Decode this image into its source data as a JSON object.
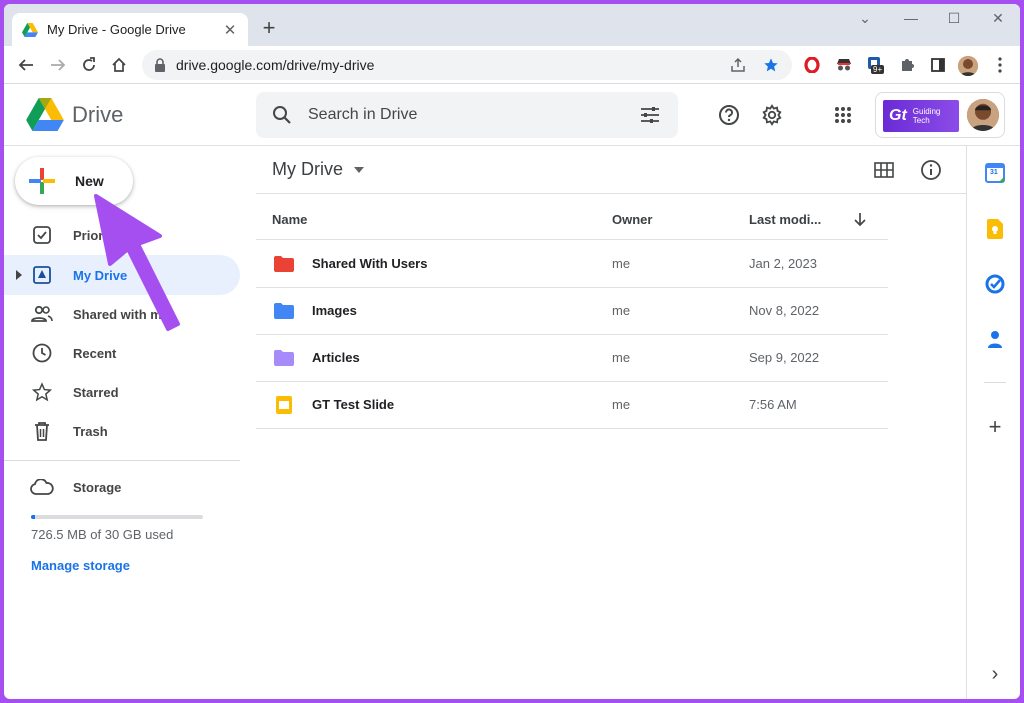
{
  "browser": {
    "tab_title": "My Drive - Google Drive",
    "tab_close": "✕",
    "new_tab": "+",
    "window_controls": [
      "⌄",
      "—",
      "☐",
      "✕"
    ],
    "url": "drive.google.com/drive/my-drive",
    "extension_badge": "9+"
  },
  "header": {
    "app_name": "Drive",
    "search_placeholder": "Search in Drive",
    "account_brand_line1": "Guiding",
    "account_brand_line2": "Tech"
  },
  "sidebar": {
    "new_label": "New",
    "items": [
      {
        "label": "Priori",
        "icon": "check-box-icon"
      },
      {
        "label": "My Drive",
        "icon": "drive-icon",
        "active": true
      },
      {
        "label": "Shared with me",
        "icon": "people-icon"
      },
      {
        "label": "Recent",
        "icon": "clock-icon"
      },
      {
        "label": "Starred",
        "icon": "star-icon"
      },
      {
        "label": "Trash",
        "icon": "trash-icon"
      }
    ],
    "storage_label": "Storage",
    "storage_used_fraction": 0.024,
    "storage_usage": "726.5 MB of 30 GB used",
    "manage_storage": "Manage storage"
  },
  "main": {
    "title": "My Drive",
    "columns": {
      "name": "Name",
      "owner": "Owner",
      "modified": "Last modi..."
    },
    "files": [
      {
        "name": "Shared With Users",
        "owner": "me",
        "modified": "Jan 2, 2023",
        "type": "folder",
        "color": "#ea4335"
      },
      {
        "name": "Images",
        "owner": "me",
        "modified": "Nov 8, 2022",
        "type": "folder",
        "color": "#4285f4"
      },
      {
        "name": "Articles",
        "owner": "me",
        "modified": "Sep 9, 2022",
        "type": "folder",
        "color": "#a78bfa"
      },
      {
        "name": "GT Test Slide",
        "owner": "me",
        "modified": "7:56 AM",
        "type": "slides",
        "color": "#fbbc04"
      }
    ]
  },
  "right_panel": {
    "calendar_day": "31",
    "add": "+",
    "expand": "›"
  },
  "colors": {
    "accent": "#1a73e8",
    "annotation_arrow": "#a64ff0"
  }
}
